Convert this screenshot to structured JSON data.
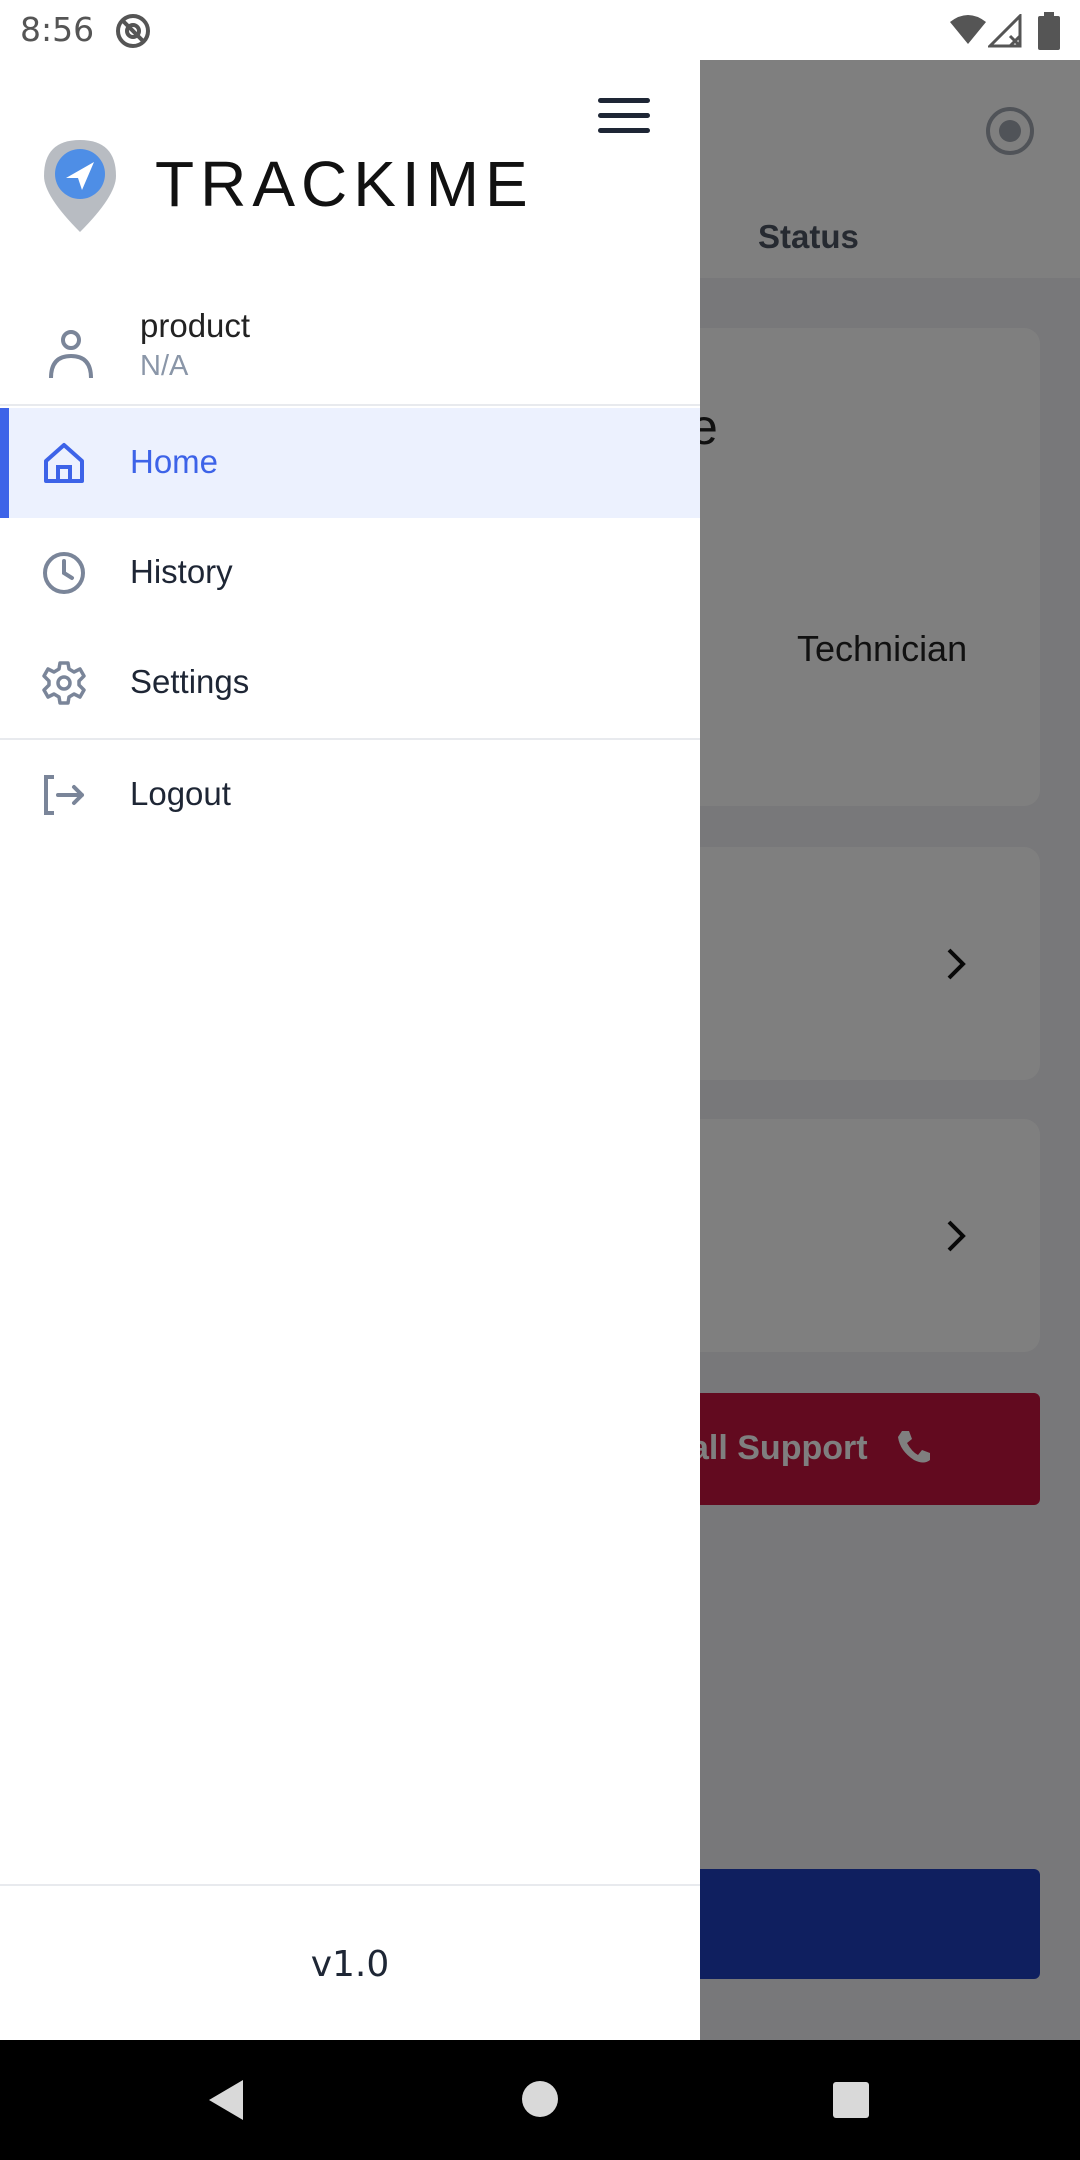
{
  "status_bar": {
    "time": "8:56",
    "icons": [
      "at-sign-icon",
      "wifi-icon",
      "no-signal-icon",
      "battery-icon"
    ]
  },
  "background": {
    "status_tab": "Status",
    "partial_text": "e",
    "role": "Technician",
    "support_button": "all Support"
  },
  "drawer": {
    "brand": "TRACKIME",
    "user": {
      "name": "product",
      "subtitle": "N/A"
    },
    "nav": [
      {
        "label": "Home",
        "icon": "home-icon",
        "active": true
      },
      {
        "label": "History",
        "icon": "clock-icon",
        "active": false
      },
      {
        "label": "Settings",
        "icon": "gear-icon",
        "active": false
      },
      {
        "label": "Logout",
        "icon": "logout-icon",
        "active": false
      }
    ],
    "version": "v1.0"
  },
  "colors": {
    "accent": "#3d63e8",
    "active_bg": "#ecf1fe",
    "support": "#c4143e",
    "primary_button": "#1f3fbf"
  }
}
